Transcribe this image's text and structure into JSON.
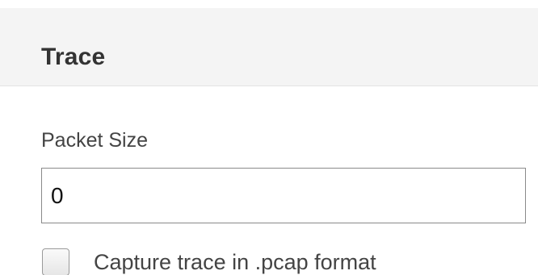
{
  "panel": {
    "title": "Trace"
  },
  "packet_size": {
    "label": "Packet Size",
    "value": "0"
  },
  "capture_pcap": {
    "label": "Capture trace in .pcap format",
    "checked": false
  }
}
